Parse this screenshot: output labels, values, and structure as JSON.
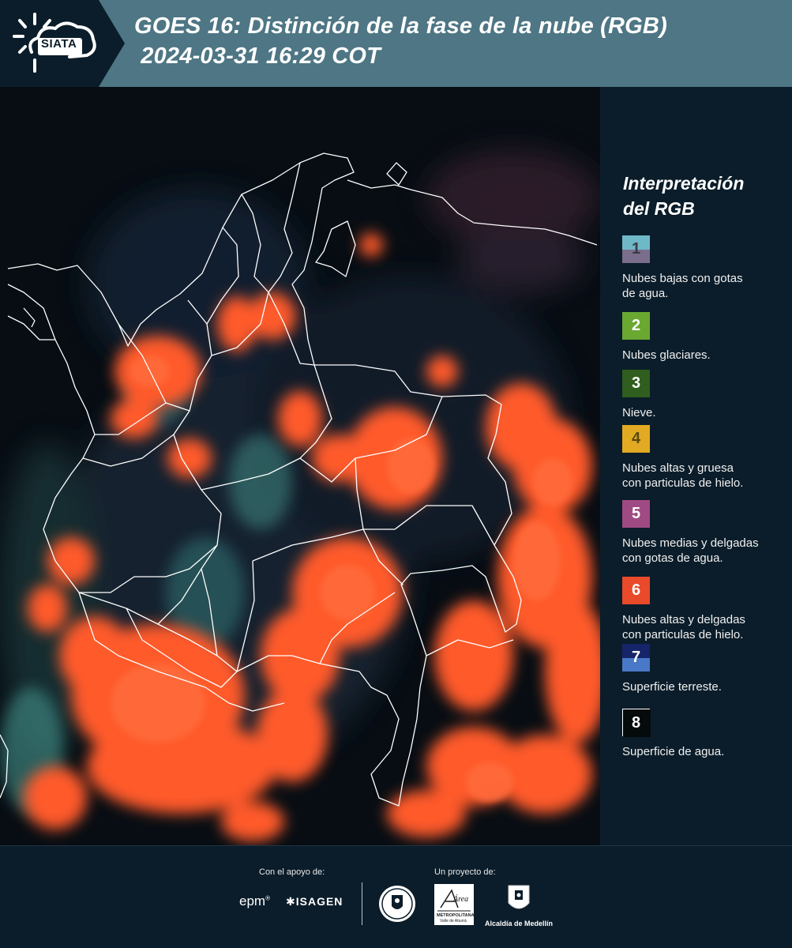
{
  "header": {
    "logo_text": "SIATA",
    "title_line1": "GOES 16: Distinción de la fase de la nube (RGB)",
    "title_line2": " 2024-03-31 16:29 COT",
    "background_color": "#4e7684",
    "logo_panel_color": "#0b1d2a"
  },
  "map": {
    "subject": "Colombia",
    "background_color": "#060b10",
    "cloud_color": "#ff5a2a",
    "border_color": "#ffffff"
  },
  "legend": {
    "title_line1": "Interpretación",
    "title_line2": "del RGB",
    "items": [
      {
        "number": "1",
        "label_line1": "Nubes bajas con gotas",
        "label_line2": "de agua.",
        "color_top": "#6fb8c8",
        "color_bottom": "#7b6e8c",
        "number_color": "#3a3a48"
      },
      {
        "number": "2",
        "label_line1": "Nubes glaciares.",
        "label_line2": "",
        "color_top": "#6aa832",
        "color_bottom": "#6aa832",
        "number_color": "#ffffff"
      },
      {
        "number": "3",
        "label_line1": "Nieve.",
        "label_line2": "",
        "color_top": "#2f5e1e",
        "color_bottom": "#2f5e1e",
        "number_color": "#ffffff"
      },
      {
        "number": "4",
        "label_line1": "Nubes altas y gruesa",
        "label_line2": "con particulas de hielo.",
        "color_top": "#e2aa22",
        "color_bottom": "#e2aa22",
        "number_color": "#5a4a10"
      },
      {
        "number": "5",
        "label_line1": "Nubes medias y delgadas",
        "label_line2": "con gotas de agua.",
        "color_top": "#a04a84",
        "color_bottom": "#a04a84",
        "number_color": "#ffffff"
      },
      {
        "number": "6",
        "label_line1": "Nubes altas y delgadas",
        "label_line2": "con particulas de hielo.",
        "color_top": "#e84a2a",
        "color_bottom": "#e84a2a",
        "number_color": "#ffffff"
      },
      {
        "number": "7",
        "label_line1": "Superficie terreste.",
        "label_line2": "",
        "color_top": "#16246a",
        "color_bottom": "#4a78c8",
        "number_color": "#ffffff"
      },
      {
        "number": "8",
        "label_line1": "Superficie de agua.",
        "label_line2": "",
        "color_top": "#050a0a",
        "color_bottom": "#050a0a",
        "number_color": "#ffffff"
      }
    ]
  },
  "footer": {
    "support_label": "Con el apoyo de:",
    "project_label": "Un proyecto de:",
    "epm_text": "epm",
    "epm_sup": "®",
    "isagen_text": "ISAGEN",
    "amva_text1": "Área",
    "amva_text2": "METROPOLITANA",
    "amva_text3": "Valle de Aburrá",
    "medellin_text": "Alcaldía de Medellín"
  }
}
